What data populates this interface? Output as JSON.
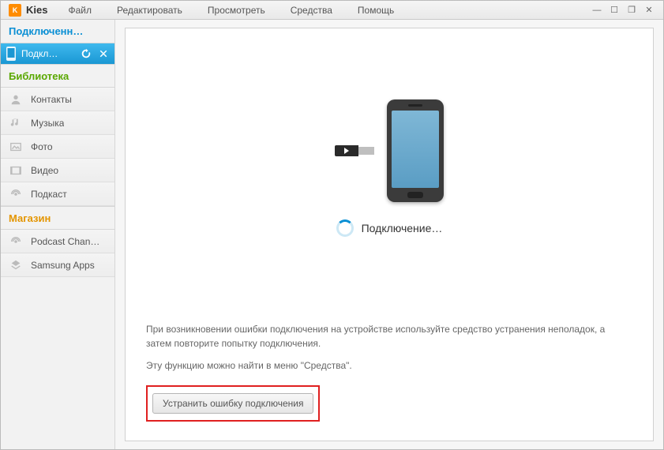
{
  "app": {
    "name": "Kies"
  },
  "menu": {
    "file": "Файл",
    "edit": "Редактировать",
    "view": "Просмотреть",
    "tools": "Средства",
    "help": "Помощь"
  },
  "sidebar": {
    "connected_header": "Подключенн…",
    "device": {
      "label": "Подкл…"
    },
    "library_header": "Библиотека",
    "library": {
      "contacts": "Контакты",
      "music": "Музыка",
      "photo": "Фото",
      "video": "Видео",
      "podcast": "Подкаст"
    },
    "store_header": "Магазин",
    "store": {
      "podcast_channel": "Podcast Chan…",
      "samsung_apps": "Samsung Apps"
    }
  },
  "main": {
    "connecting": "Подключение…",
    "help_line1": "При возникновении ошибки подключения на устройстве используйте средство устранения неполадок, а затем повторите попытку подключения.",
    "help_line2": "Эту функцию можно найти в меню \"Средства\".",
    "fix_button": "Устранить ошибку подключения"
  }
}
